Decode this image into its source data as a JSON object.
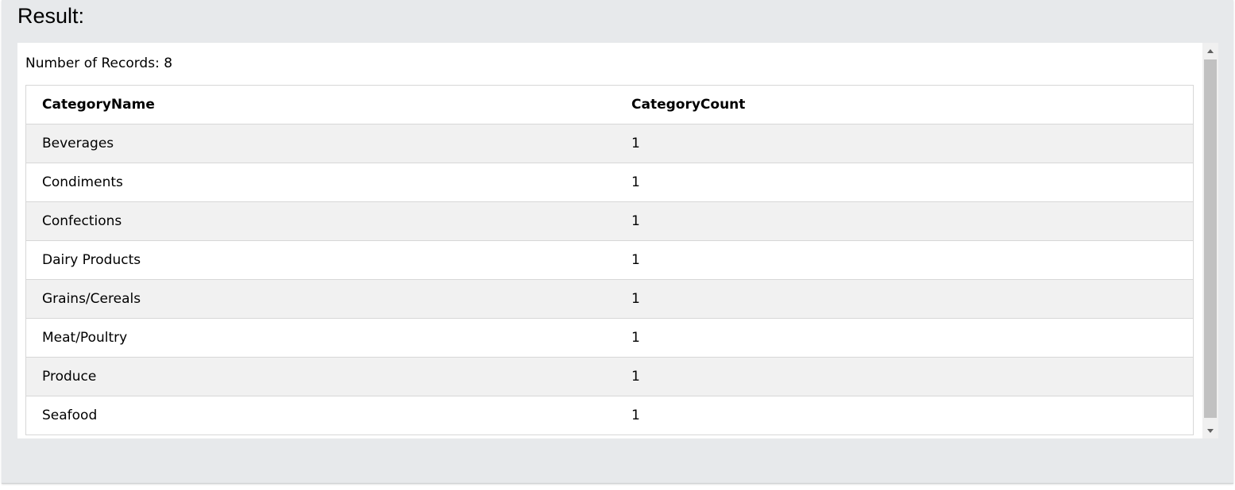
{
  "heading": "Result:",
  "records": {
    "label": "Number of Records:",
    "count": "8"
  },
  "table": {
    "columns": [
      "CategoryName",
      "CategoryCount"
    ],
    "rows": [
      [
        "Beverages",
        "1"
      ],
      [
        "Condiments",
        "1"
      ],
      [
        "Confections",
        "1"
      ],
      [
        "Dairy Products",
        "1"
      ],
      [
        "Grains/Cereals",
        "1"
      ],
      [
        "Meat/Poultry",
        "1"
      ],
      [
        "Produce",
        "1"
      ],
      [
        "Seafood",
        "1"
      ]
    ]
  },
  "colors": {
    "panel_background": "#e7e9eb",
    "stripe": "#f1f1f1",
    "border": "#d7d7d7",
    "scroll_thumb": "#c1c1c1"
  },
  "icons": {
    "scroll_up": "scroll-up-arrow-icon",
    "scroll_down": "scroll-down-arrow-icon"
  }
}
